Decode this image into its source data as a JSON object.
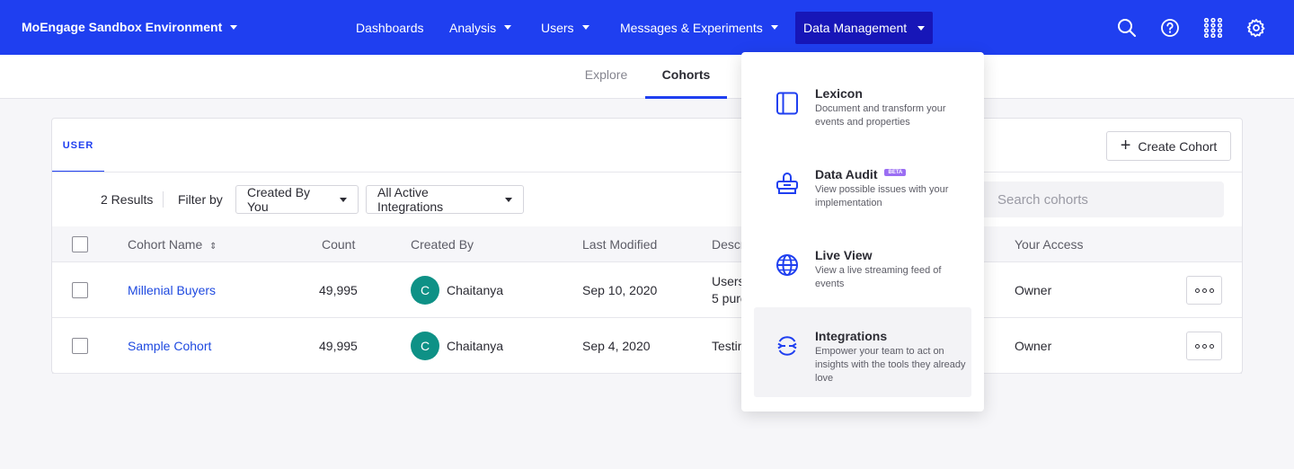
{
  "topbar": {
    "environment": "MoEngage Sandbox Environment",
    "nav": [
      "Dashboards",
      "Analysis",
      "Users",
      "Messages & Experiments",
      "Data Management"
    ],
    "icons": [
      "search-icon",
      "help-icon",
      "apps-grid-icon",
      "settings-icon"
    ],
    "color": "#1f3ff0"
  },
  "subtabs": [
    "Explore",
    "Cohorts"
  ],
  "card": {
    "tab": "USER",
    "create_label": "Create Cohort",
    "results": "2 Results",
    "filter_label": "Filter by",
    "filter_created": "Created By You",
    "filter_integrations": "All Active Integrations",
    "search_placeholder": "Search cohorts",
    "columns": {
      "name": "Cohort Name",
      "count": "Count",
      "created_by": "Created By",
      "modified": "Last Modified",
      "description": "Descr",
      "access": "Your Access"
    },
    "rows": [
      {
        "name": "Millenial Buyers",
        "count": "49,995",
        "initial": "C",
        "creator": "Chaitanya",
        "modified": "Sep 10, 2020",
        "desc1": "Users",
        "desc2": "5 purc",
        "access": "Owner"
      },
      {
        "name": "Sample Cohort",
        "count": "49,995",
        "initial": "C",
        "creator": "Chaitanya",
        "modified": "Sep 4, 2020",
        "desc1": "Testin",
        "desc2": "",
        "access": "Owner"
      }
    ]
  },
  "menu": {
    "items": [
      {
        "title": "Lexicon",
        "desc": "Document and transform your events and properties",
        "icon": "book-icon"
      },
      {
        "title": "Data Audit",
        "badge": "BETA",
        "desc": "View possible issues with your implementation",
        "icon": "audit-icon"
      },
      {
        "title": "Live View",
        "desc": "View a live streaming feed of events",
        "icon": "globe-icon"
      },
      {
        "title": "Integrations",
        "desc": "Empower your team to act on insights with the tools they already love",
        "icon": "integrations-icon"
      }
    ]
  }
}
